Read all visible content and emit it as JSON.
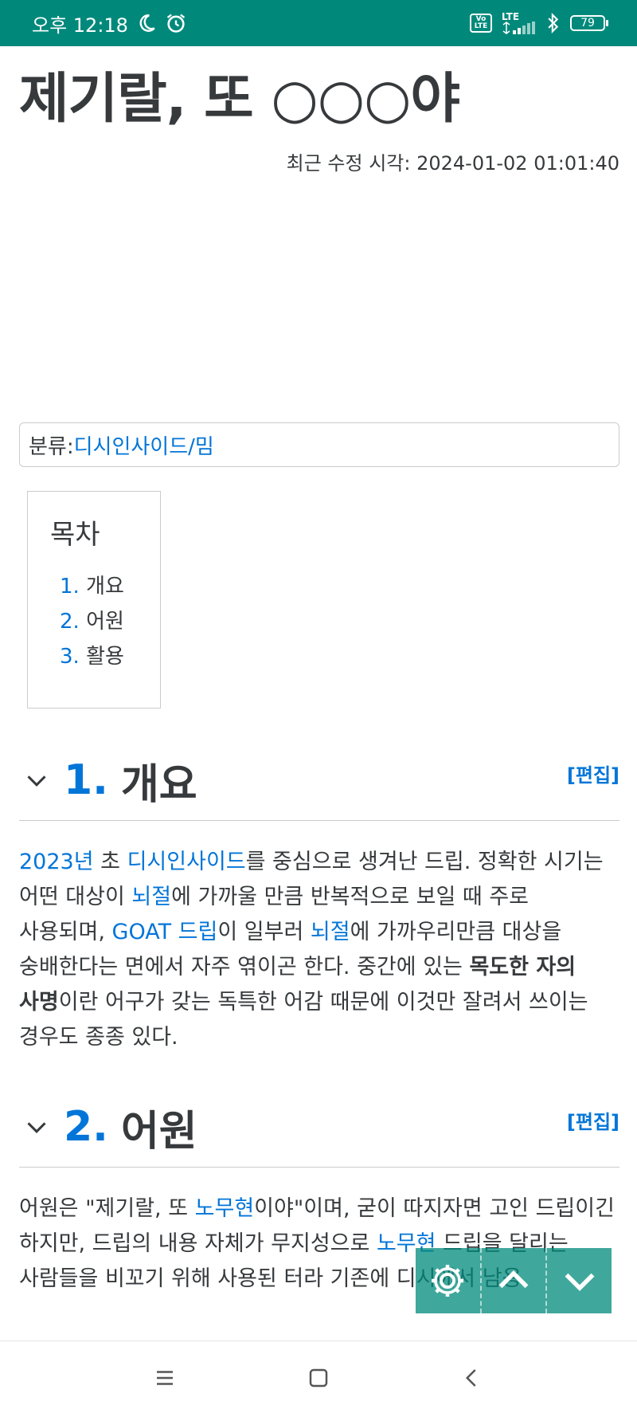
{
  "status": {
    "time": "오후 12:18",
    "network": "LTE",
    "volte": "Vo LTE",
    "battery": "79"
  },
  "page": {
    "title": "제기랄, 또 ○○○야",
    "modified": "최근 수정 시각: 2024-01-02 01:01:40"
  },
  "category": {
    "label": "분류: ",
    "link": "디시인사이드/밈"
  },
  "toc": {
    "title": "목차",
    "items": [
      {
        "num": "1.",
        "label": "개요"
      },
      {
        "num": "2.",
        "label": "어원"
      },
      {
        "num": "3.",
        "label": "활용"
      }
    ]
  },
  "sections": [
    {
      "num": "1.",
      "title": "개요",
      "edit": "[편집]",
      "body": {
        "l1": "2023년",
        "t1": " 초 ",
        "l2": "디시인사이드",
        "t2": "를 중심으로 생겨난 드립. 정확한 시기는 어떤 대상이 ",
        "l3": "뇌절",
        "t3": "에 가까울 만큼 반복적으로 보일 때 주로 사용되며, ",
        "l4": "GOAT 드립",
        "t4": "이 일부러 ",
        "l5": "뇌절",
        "t5": "에 가까우리만큼 대상을 숭배한다는 면에서 자주 엮이곤 한다. 중간에 있는 ",
        "b1": "목도한 자의 사명",
        "t6": "이란 어구가 갖는 독특한 어감 때문에 이것만 잘려서 쓰이는 경우도 종종 있다."
      }
    },
    {
      "num": "2.",
      "title": "어원",
      "edit": "[편집]",
      "body": {
        "t1": "어원은 \"제기랄, 또 ",
        "l1": "노무현",
        "t2": "이야\"이며, 굳이 따지자면 고인 드립이긴 하지만, 드립의 내용 자체가 무지성으로 ",
        "l2": "노무현",
        "t3": " 드립을 달리는 사람들을 비꼬기 위해 사용된 터라 기존에 디시에서 남용"
      }
    }
  ],
  "colors": {
    "accent": "#00897b",
    "link": "#0275d8",
    "text": "#373a3c"
  }
}
